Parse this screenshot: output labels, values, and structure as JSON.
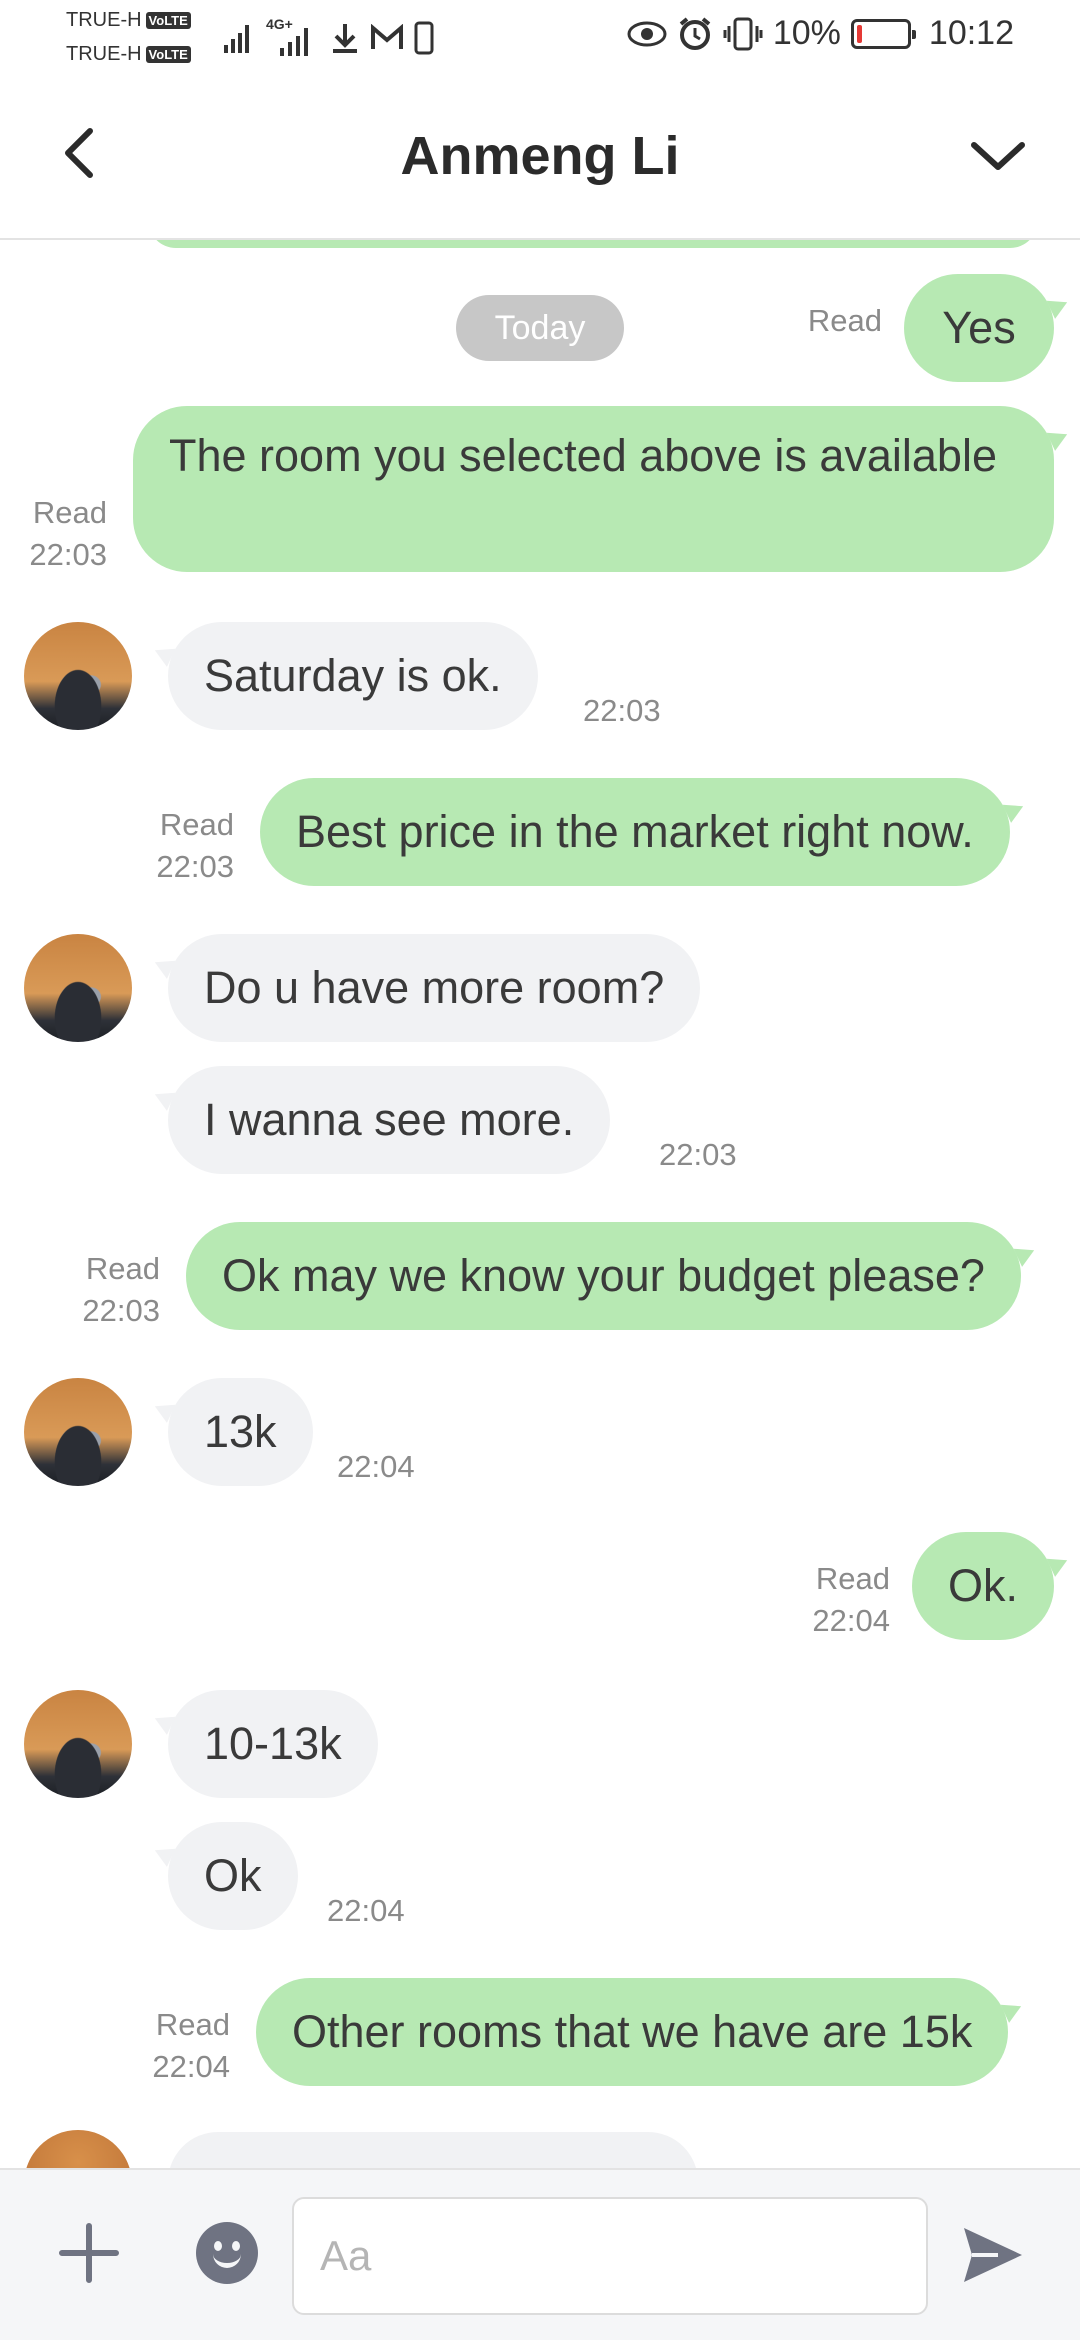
{
  "status_bar": {
    "carrier1": "TRUE-H",
    "carrier2": "TRUE-H",
    "volte": "VoLTE",
    "network": "4G+",
    "battery": "10%",
    "time": "10:12",
    "icons": [
      "signal-icon",
      "download-icon",
      "gmail-icon",
      "phone-icon",
      "eye-icon",
      "alarm-icon",
      "vibrate-icon",
      "battery-icon"
    ]
  },
  "header": {
    "title": "Anmeng Li",
    "back_icon": "chevron-left-icon",
    "menu_icon": "chevron-down-icon"
  },
  "chat": {
    "date_chip": "Today",
    "messages": [
      {
        "dir": "out",
        "text": "Yes",
        "read": "Read",
        "time": ""
      },
      {
        "dir": "out",
        "text": "The room you selected above is available",
        "read": "Read",
        "time": "22:03"
      },
      {
        "dir": "in",
        "text": "Saturday is ok.",
        "time": "22:03"
      },
      {
        "dir": "out",
        "text": "Best price in the market right now.",
        "read": "Read",
        "time": "22:03"
      },
      {
        "dir": "in",
        "text": "Do u have more room?",
        "time": ""
      },
      {
        "dir": "in",
        "text": "I wanna see more.",
        "time": "22:03"
      },
      {
        "dir": "out",
        "text": "Ok may we know your budget please?",
        "read": "Read",
        "time": "22:03"
      },
      {
        "dir": "in",
        "text": "13k",
        "time": "22:04"
      },
      {
        "dir": "out",
        "text": "Ok.",
        "read": "Read",
        "time": "22:04"
      },
      {
        "dir": "in",
        "text": "10-13k",
        "time": ""
      },
      {
        "dir": "in",
        "text": "Ok",
        "time": "22:04"
      },
      {
        "dir": "out",
        "text": "Other rooms that we have are 15k",
        "read": "Read",
        "time": "22:04"
      }
    ]
  },
  "input_bar": {
    "placeholder": "Aa",
    "plus_icon": "plus-icon",
    "emoji_icon": "emoji-icon",
    "send_icon": "send-icon"
  },
  "colors": {
    "outgoing_bubble": "#b7e9b3",
    "incoming_bubble": "#f1f2f4",
    "date_chip": "#c7c7c7",
    "meta_text": "#8a8a8a"
  }
}
